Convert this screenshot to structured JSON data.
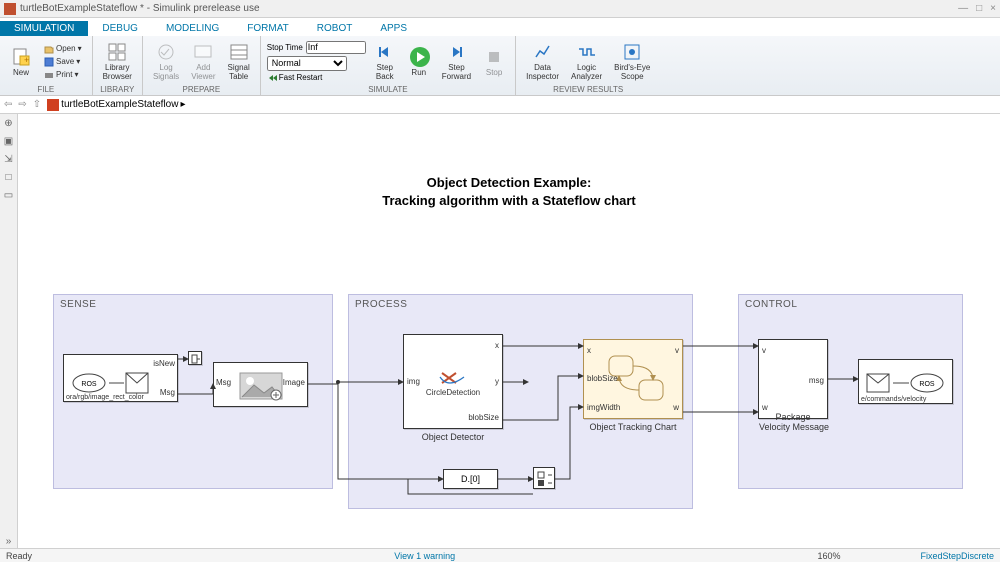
{
  "window": {
    "title": "turtleBotExampleStateflow * - Simulink prerelease use",
    "controls": {
      "min": "—",
      "max": "□",
      "close": "×"
    }
  },
  "tabs": [
    "SIMULATION",
    "DEBUG",
    "MODELING",
    "FORMAT",
    "ROBOT",
    "APPS"
  ],
  "activeTab": 0,
  "ribbon": {
    "file": {
      "label": "FILE",
      "new": "New",
      "open": "Open",
      "save": "Save",
      "print": "Print"
    },
    "library": {
      "label": "LIBRARY",
      "browser": "Library\nBrowser"
    },
    "prepare": {
      "label": "PREPARE",
      "logSignals": "Log\nSignals",
      "addViewer": "Add\nViewer",
      "signalTable": "Signal\nTable"
    },
    "simulate": {
      "label": "SIMULATE",
      "stopTimeLbl": "Stop Time",
      "stopTimeVal": "Inf",
      "modeNormal": "Normal",
      "fastRestart": "Fast Restart",
      "stepBack": "Step\nBack",
      "run": "Run",
      "stepFwd": "Step\nForward",
      "stop": "Stop"
    },
    "review": {
      "label": "REVIEW RESULTS",
      "dataInspector": "Data\nInspector",
      "logicAnalyzer": "Logic\nAnalyzer",
      "birdsEye": "Bird's-Eye\nScope"
    }
  },
  "crumb": {
    "model": "turtleBotExampleStateflow"
  },
  "diagram": {
    "title1": "Object Detection Example:",
    "title2": "Tracking algorithm with a Stateflow chart",
    "panels": {
      "sense": "SENSE",
      "process": "PROCESS",
      "control": "CONTROL"
    },
    "blocks": {
      "subscribe": {
        "topic": "ora/rgb/image_rect_color",
        "isNew": "isNew",
        "msg": "Msg",
        "ros": "ROS"
      },
      "readImage": {
        "in": "Msg",
        "out": "Image"
      },
      "circleDetect": {
        "caption": "Object Detector",
        "fn": "CircleDetection",
        "inImg": "img",
        "outX": "x",
        "outY": "y",
        "outBlob": "blobSize"
      },
      "widthConst": {
        "value": "D.[0]"
      },
      "tracking": {
        "caption": "Object Tracking Chart",
        "inX": "x",
        "inBlob": "blobSize",
        "inWidth": "imgWidth",
        "outV": "v",
        "outW": "w"
      },
      "package": {
        "caption": "Package\nVelocity Message",
        "inV": "v",
        "inW": "w",
        "outMsg": "msg"
      },
      "publish": {
        "topic": "e/commands/velocity",
        "ros": "ROS"
      }
    }
  },
  "status": {
    "ready": "Ready",
    "warning": "View 1 warning",
    "zoom": "160%",
    "solver": "FixedStepDiscrete"
  }
}
